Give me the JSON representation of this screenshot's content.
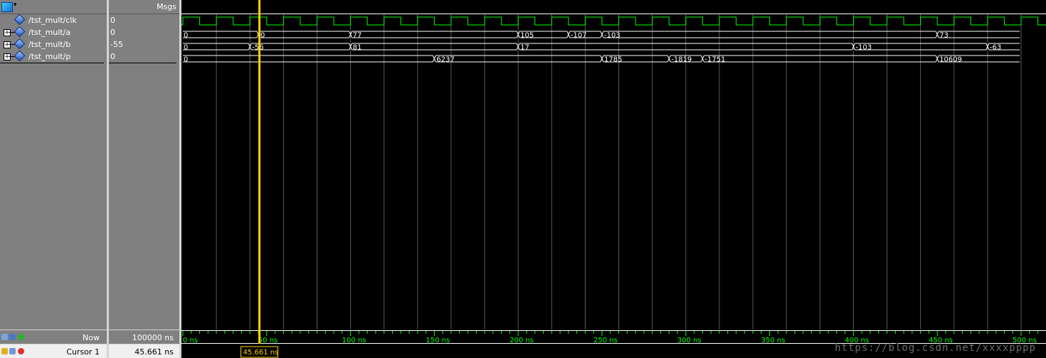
{
  "header": {
    "msgs_label": "Msgs",
    "toolbar_icon": "wave-layout-icon"
  },
  "signals": [
    {
      "name": "/tst_mult/clk",
      "value": "0",
      "expandable": false
    },
    {
      "name": "/tst_mult/a",
      "value": "0",
      "expandable": true
    },
    {
      "name": "/tst_mult/b",
      "value": "-55",
      "expandable": true
    },
    {
      "name": "/tst_mult/p",
      "value": "0",
      "expandable": true
    }
  ],
  "waveforms": {
    "clock_period_ns": 20,
    "clock_start_level": 0,
    "buses": [
      {
        "signal": "/tst_mult/a",
        "transitions": [
          [
            0,
            "0"
          ],
          [
            45,
            "0"
          ],
          [
            100,
            "77"
          ],
          [
            200,
            "105"
          ],
          [
            230,
            "-107"
          ],
          [
            250,
            "-103"
          ],
          [
            450,
            "73"
          ],
          [
            500,
            ""
          ]
        ]
      },
      {
        "signal": "/tst_mult/b",
        "transitions": [
          [
            0,
            "0"
          ],
          [
            40,
            "-56"
          ],
          [
            100,
            "81"
          ],
          [
            200,
            "17"
          ],
          [
            400,
            "-103"
          ],
          [
            480,
            "-63"
          ],
          [
            500,
            ""
          ]
        ]
      },
      {
        "signal": "/tst_mult/p",
        "transitions": [
          [
            0,
            "0"
          ],
          [
            150,
            "6237"
          ],
          [
            250,
            "1785"
          ],
          [
            290,
            "-1819"
          ],
          [
            310,
            "-1751"
          ],
          [
            450,
            "10609"
          ],
          [
            500,
            ""
          ]
        ]
      }
    ]
  },
  "timeline": {
    "ticks": [
      "0 ns",
      "50 ns",
      "100 ns",
      "150 ns",
      "200 ns",
      "250 ns",
      "300 ns",
      "350 ns",
      "400 ns",
      "450 ns",
      "500 ns"
    ],
    "range_ns": [
      0,
      510
    ]
  },
  "bottom": {
    "now_label": "Now",
    "now_value": "100000 ns",
    "cursor_label": "Cursor 1",
    "cursor_value": "45.661 ns",
    "cursor_time_ns": 45.661,
    "cursor_badge": "45.661 ns"
  },
  "watermark": "https://blog.csdn.net/xxxxpppp",
  "colors": {
    "wave": "#00ff00",
    "bus_text": "#ffffff",
    "cursor": "#ffd000",
    "grid": "#5a5a5a",
    "timeline": "#00ff00"
  }
}
